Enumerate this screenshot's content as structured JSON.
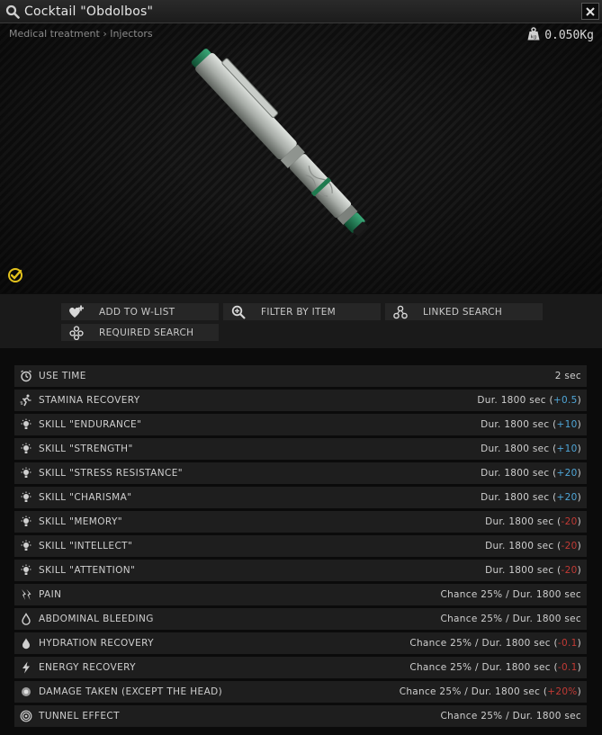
{
  "window": {
    "title": "Cocktail \"Obdolbos\"",
    "title_icon": "search-icon",
    "close_icon": "close-icon"
  },
  "preview": {
    "breadcrumb": "Medical treatment › Injectors",
    "weight": "0.050Kg",
    "weight_icon": "weight-icon",
    "examined_icon": "examined-check-icon"
  },
  "actions": [
    {
      "label": "ADD TO W-LIST",
      "icon": "wishlist-add-icon"
    },
    {
      "label": "FILTER BY ITEM",
      "icon": "filter-search-icon"
    },
    {
      "label": "LINKED SEARCH",
      "icon": "linked-search-icon"
    },
    {
      "label": "REQUIRED SEARCH",
      "icon": "required-search-icon"
    }
  ],
  "stats": [
    {
      "name": "USE TIME",
      "icon": "clock-icon",
      "value": "2 sec"
    },
    {
      "name": "STAMINA RECOVERY",
      "icon": "running-icon",
      "value_pre": "Dur. 1800 sec (",
      "delta": "+0.5",
      "delta_kind": "pos",
      "value_post": ")"
    },
    {
      "name": "SKILL \"ENDURANCE\"",
      "icon": "skill-bulb-icon",
      "value_pre": "Dur. 1800 sec (",
      "delta": "+10",
      "delta_kind": "pos",
      "value_post": ")"
    },
    {
      "name": "SKILL \"STRENGTH\"",
      "icon": "skill-bulb-icon",
      "value_pre": "Dur. 1800 sec (",
      "delta": "+10",
      "delta_kind": "pos",
      "value_post": ")"
    },
    {
      "name": "SKILL \"STRESS RESISTANCE\"",
      "icon": "skill-bulb-icon",
      "value_pre": "Dur. 1800 sec (",
      "delta": "+20",
      "delta_kind": "pos",
      "value_post": ")"
    },
    {
      "name": "SKILL \"CHARISMA\"",
      "icon": "skill-bulb-icon",
      "value_pre": "Dur. 1800 sec (",
      "delta": "+20",
      "delta_kind": "pos",
      "value_post": ")"
    },
    {
      "name": "SKILL \"MEMORY\"",
      "icon": "skill-bulb-icon",
      "value_pre": "Dur. 1800 sec (",
      "delta": "-20",
      "delta_kind": "neg",
      "value_post": ")"
    },
    {
      "name": "SKILL \"INTELLECT\"",
      "icon": "skill-bulb-icon",
      "value_pre": "Dur. 1800 sec (",
      "delta": "-20",
      "delta_kind": "neg",
      "value_post": ")"
    },
    {
      "name": "SKILL \"ATTENTION\"",
      "icon": "skill-bulb-icon",
      "value_pre": "Dur. 1800 sec (",
      "delta": "-20",
      "delta_kind": "neg",
      "value_post": ")"
    },
    {
      "name": "PAIN",
      "icon": "pain-icon",
      "value": "Chance 25% / Dur. 1800 sec"
    },
    {
      "name": "ABDOMINAL BLEEDING",
      "icon": "blood-drop-icon",
      "value": "Chance 25% / Dur. 1800 sec"
    },
    {
      "name": "HYDRATION RECOVERY",
      "icon": "water-drop-icon",
      "value_pre": "Chance 25% / Dur. 1800 sec (",
      "delta": "-0.1",
      "delta_kind": "neg",
      "value_post": ")"
    },
    {
      "name": "ENERGY RECOVERY",
      "icon": "lightning-icon",
      "value_pre": "Chance 25% / Dur. 1800 sec (",
      "delta": "-0.1",
      "delta_kind": "neg",
      "value_post": ")"
    },
    {
      "name": "DAMAGE TAKEN (EXCEPT THE HEAD)",
      "icon": "damage-icon",
      "value_pre": "Chance 25% / Dur. 1800 sec (",
      "delta": "+20%",
      "delta_kind": "neg",
      "value_post": ")"
    },
    {
      "name": "TUNNEL EFFECT",
      "icon": "tunnel-effect-icon",
      "value": "Chance 25% / Dur. 1800 sec"
    }
  ],
  "colors": {
    "positive": "#4fa6d8",
    "negative": "#c23a35",
    "examined": "#e3c21c",
    "injector_cap": "#1f7a4f"
  }
}
